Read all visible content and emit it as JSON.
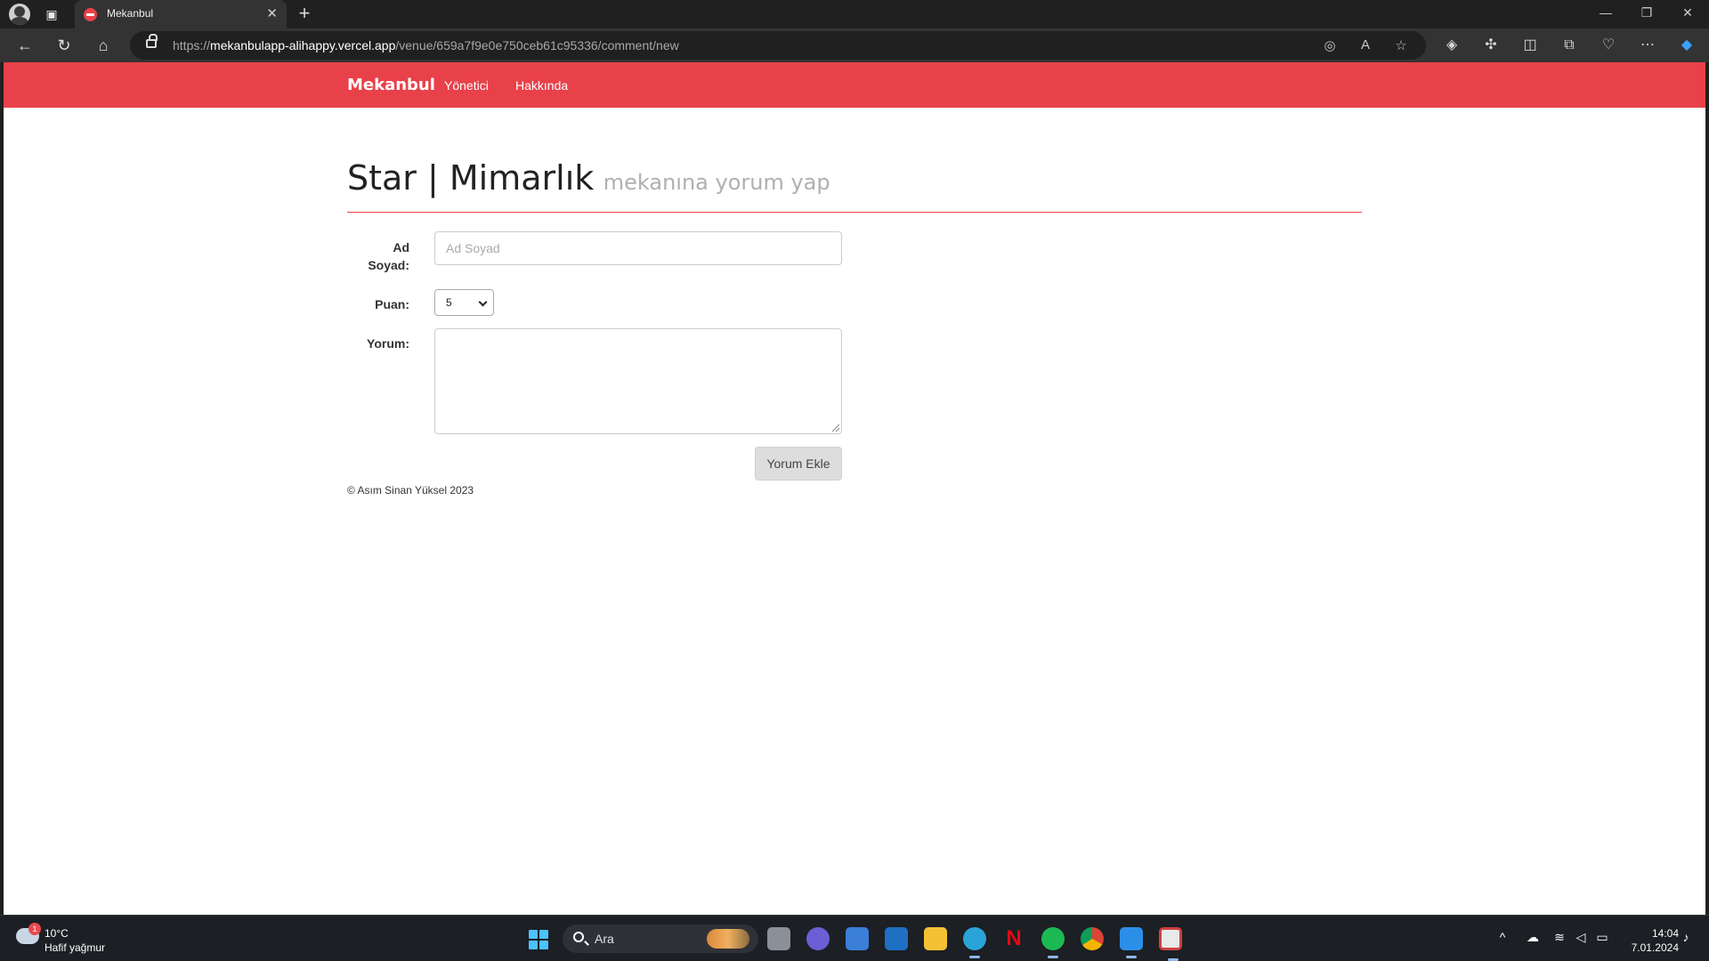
{
  "browser": {
    "tab_title": "Mekanbul",
    "url_scheme": "https://",
    "url_host": "mekanbulapp-alihappy.vercel.app",
    "url_path": "/venue/659a7f9e0e750ceb61c95336/comment/new"
  },
  "navbar": {
    "brand": "Mekanbul",
    "links": [
      "Yönetici",
      "Hakkında"
    ],
    "color": "#e8414a"
  },
  "page": {
    "venue_name": "Star | Mimarlık",
    "subtitle": "mekanına yorum yap"
  },
  "form": {
    "name_label_line1": "Ad",
    "name_label_line2": "Soyad:",
    "name_placeholder": "Ad Soyad",
    "name_value": "",
    "rating_label": "Puan:",
    "rating_value": "5",
    "comment_label": "Yorum:",
    "comment_value": "",
    "submit_label": "Yorum Ekle"
  },
  "footer": {
    "text": "© Asım Sinan Yüksel 2023"
  },
  "taskbar": {
    "weather_temp": "10°C",
    "weather_desc": "Hafif yağmur",
    "weather_badge": "1",
    "search_text": "Ara",
    "time": "14:04",
    "date": "7.01.2024"
  }
}
